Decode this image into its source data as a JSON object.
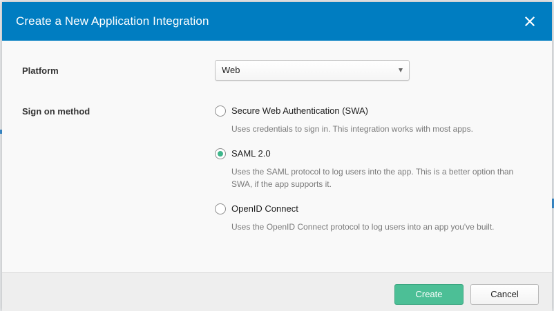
{
  "dialog": {
    "title": "Create a New Application Integration",
    "close_icon": "close-icon"
  },
  "platform": {
    "label": "Platform",
    "selected": "Web"
  },
  "sign_on": {
    "label": "Sign on method",
    "options": [
      {
        "label": "Secure Web Authentication (SWA)",
        "description": "Uses credentials to sign in. This integration works with most apps.",
        "checked": false
      },
      {
        "label": "SAML 2.0",
        "description": "Uses the SAML protocol to log users into the app. This is a better option than SWA, if the app supports it.",
        "checked": true
      },
      {
        "label": "OpenID Connect",
        "description": "Uses the OpenID Connect protocol to log users into an app you've built.",
        "checked": false
      }
    ]
  },
  "footer": {
    "create_label": "Create",
    "cancel_label": "Cancel"
  },
  "colors": {
    "header": "#007dc1",
    "primary_button": "#4cbf96",
    "radio_selected": "#3fb68b"
  }
}
